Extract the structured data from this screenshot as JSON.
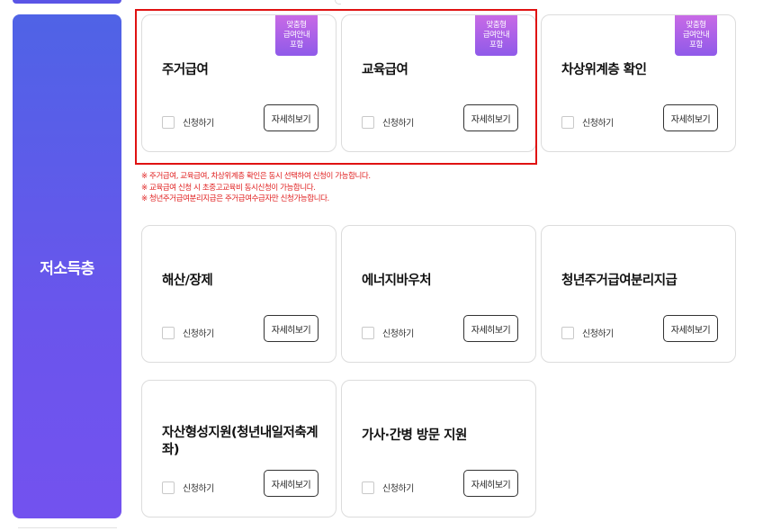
{
  "category": {
    "label": "저소득층"
  },
  "badge_lines": [
    "맞춤형",
    "급여안내",
    "포함"
  ],
  "cards": [
    {
      "title": "주거급여",
      "checkbox_label": "신청하기",
      "detail_label": "자세히보기"
    },
    {
      "title": "교육급여",
      "checkbox_label": "신청하기",
      "detail_label": "자세히보기"
    },
    {
      "title": "차상위계층 확인",
      "checkbox_label": "신청하기",
      "detail_label": "자세히보기"
    },
    {
      "title": "해산/장제",
      "checkbox_label": "신청하기",
      "detail_label": "자세히보기"
    },
    {
      "title": "에너지바우처",
      "checkbox_label": "신청하기",
      "detail_label": "자세히보기"
    },
    {
      "title": "청년주거급여분리지급",
      "checkbox_label": "신청하기",
      "detail_label": "자세히보기"
    },
    {
      "title": "자산형성지원(청년내일저축계좌)",
      "checkbox_label": "신청하기",
      "detail_label": "자세히보기"
    },
    {
      "title": "가사·간병 방문 지원",
      "checkbox_label": "신청하기",
      "detail_label": "자세히보기"
    }
  ],
  "notes": [
    "※ 주거급여, 교육급여, 차상위계층 확인은 동시 선택하여 신청이 가능합니다.",
    "※ 교육급여 신청 시 초중고교육비 동시신청이 가능합니다.",
    "※ 청년주거급여분리지급은 주거급여수급자만 신청가능합니다."
  ],
  "colors": {
    "category_gradient_top": "#4f63e6",
    "category_gradient_bottom": "#7352ef",
    "badge_gradient_top": "#c86ae6",
    "badge_gradient_bottom": "#8f5ae9",
    "note_text": "#e02020",
    "highlight_border": "#e01212"
  }
}
